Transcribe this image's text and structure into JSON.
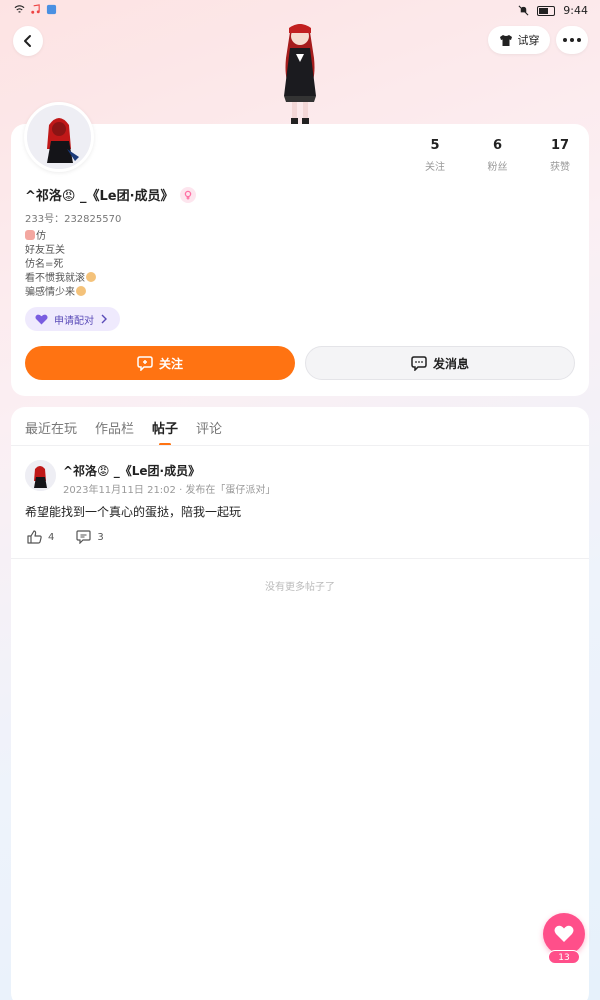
{
  "status_bar": {
    "time": "9:44"
  },
  "top_nav": {
    "try_on_label": "试穿"
  },
  "profile": {
    "nickname": "^祁洛😡 _《Le团·成员》",
    "uid": "233号：232825570",
    "bio_lines": [
      "仿",
      "好友互关",
      "仿名=死",
      "看不惯我就滚",
      "骗感情少来"
    ],
    "pair_label": "申请配对",
    "stats": [
      {
        "value": "5",
        "label": "关注"
      },
      {
        "value": "6",
        "label": "粉丝"
      },
      {
        "value": "17",
        "label": "获赞"
      }
    ],
    "follow_label": "关注",
    "message_label": "发消息"
  },
  "tabs": [
    "最近在玩",
    "作品栏",
    "帖子",
    "评论"
  ],
  "active_tab": "帖子",
  "post": {
    "author": "^祁洛😡 _《Le团·成员》",
    "meta": "2023年11月11日 21:02 · 发布在「蛋仔派对」",
    "text": "希望能找到一个真心的蛋挞，陪我一起玩",
    "likes": "4",
    "comments": "3"
  },
  "no_more_text": "没有更多帖子了",
  "fab": {
    "count": "13"
  },
  "colors": {
    "accent": "#ff7312",
    "like": "#ff4f8a",
    "pair": "#5a4bb8"
  }
}
